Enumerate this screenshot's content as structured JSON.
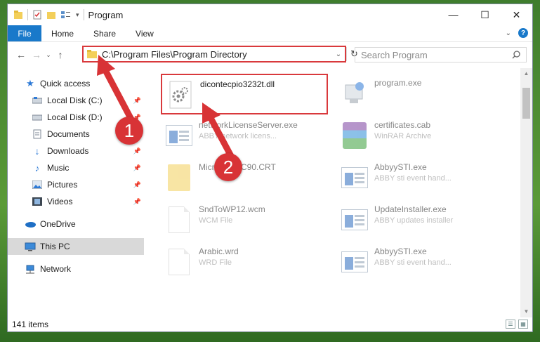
{
  "window": {
    "title": "Program",
    "controls": {
      "minimize": "—",
      "maximize": "☐",
      "close": "✕"
    }
  },
  "ribbon": {
    "tabs": [
      {
        "label": "File",
        "active": true
      },
      {
        "label": "Home"
      },
      {
        "label": "Share"
      },
      {
        "label": "View"
      }
    ]
  },
  "nav": {
    "address": "C:\\Program Files\\Program Directory",
    "search_placeholder": "Search Program"
  },
  "sidebar": {
    "items": [
      {
        "label": "Quick access",
        "icon": "star-icon"
      },
      {
        "label": "Local Disk (C:)",
        "icon": "drive-icon",
        "pinned": true
      },
      {
        "label": "Local Disk (D:)",
        "icon": "drive-icon",
        "pinned": true
      },
      {
        "label": "Documents",
        "icon": "documents-icon",
        "pinned": true
      },
      {
        "label": "Downloads",
        "icon": "downloads-icon",
        "pinned": true
      },
      {
        "label": "Music",
        "icon": "music-icon",
        "pinned": true
      },
      {
        "label": "Pictures",
        "icon": "pictures-icon",
        "pinned": true
      },
      {
        "label": "Videos",
        "icon": "videos-icon",
        "pinned": true
      },
      {
        "label": "OneDrive",
        "icon": "onedrive-icon"
      },
      {
        "label": "This PC",
        "icon": "this-pc-icon",
        "selected": true
      },
      {
        "label": "Network",
        "icon": "network-icon"
      }
    ]
  },
  "files": [
    {
      "name": "dicontecpio3232t.dll",
      "type": "",
      "icon": "dll-icon",
      "highlight": true
    },
    {
      "name": "program.exe",
      "type": "",
      "icon": "exe-icon"
    },
    {
      "name": "networkLicenseServer.exe",
      "type": "ABBY network licens...",
      "icon": "app-icon"
    },
    {
      "name": "certificates.cab",
      "type": "WinRAR Archive",
      "icon": "winrar-icon"
    },
    {
      "name": "Microsoft.VC90.CRT",
      "type": "",
      "icon": "folder-icon"
    },
    {
      "name": "AbbyySTI.exe",
      "type": "ABBY sti event hand...",
      "icon": "app-icon"
    },
    {
      "name": "SndToWP12.wcm",
      "type": "WCM File",
      "icon": "file-icon"
    },
    {
      "name": "UpdateInstaller.exe",
      "type": "ABBY updates installer",
      "icon": "app-icon"
    },
    {
      "name": "Arabic.wrd",
      "type": "WRD File",
      "icon": "file-icon"
    },
    {
      "name": "AbbyySTI.exe",
      "type": "ABBY sti event hand...",
      "icon": "app-icon"
    }
  ],
  "status": {
    "count": "141 items"
  },
  "callouts": [
    "1",
    "2"
  ],
  "colors": {
    "accent": "#1979ca",
    "highlight": "#d9393c"
  }
}
